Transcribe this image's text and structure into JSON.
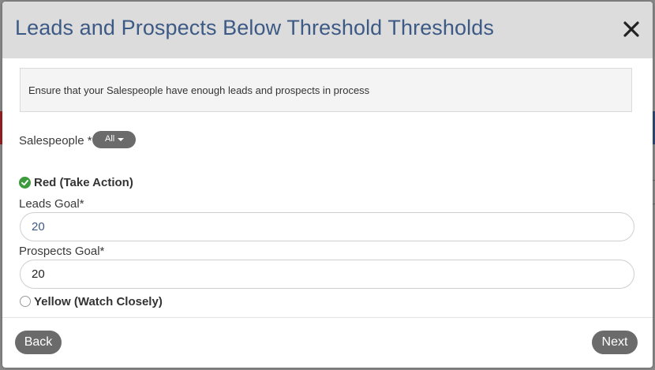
{
  "modal": {
    "title": "Leads and Prospects Below Threshold Thresholds",
    "info": "Ensure that your Salespeople have enough leads and prospects in process"
  },
  "salespeople": {
    "label": "Salespeople *",
    "selected": "All"
  },
  "levels": [
    {
      "label": "Red (Take Action)",
      "checked": true,
      "leads_goal_label": "Leads Goal*",
      "leads_goal_value": "20",
      "prospects_goal_label": "Prospects Goal*",
      "prospects_goal_value": "20"
    },
    {
      "label": "Yellow (Watch Closely)",
      "checked": false
    }
  ],
  "footer": {
    "back_label": "Back",
    "next_label": "Next"
  },
  "colors": {
    "title": "#3c5a85",
    "header_bg": "#dcdcdc",
    "button_bg": "#6b6b6b",
    "check_green": "#3d9a3d"
  },
  "icons": {
    "close": "close-icon",
    "check": "check-icon",
    "caret": "chevron-down-icon"
  }
}
